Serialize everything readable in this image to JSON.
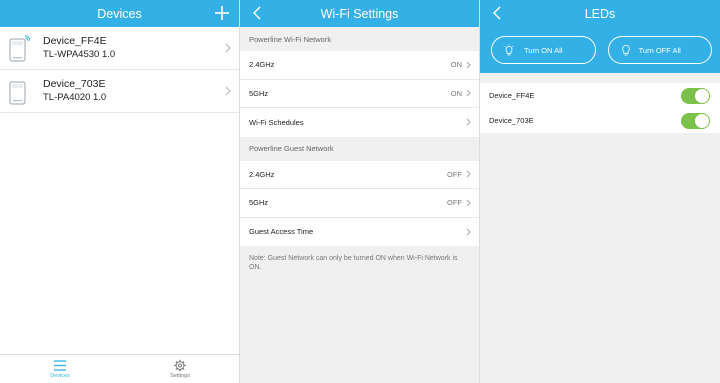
{
  "devices_panel": {
    "title": "Devices",
    "add_icon": "plus-icon",
    "devices": [
      {
        "name": "Device_FF4E",
        "model": "TL-WPA4530 1.0"
      },
      {
        "name": "Device_703E",
        "model": "TL-PA4020 1.0"
      }
    ],
    "tabs": [
      {
        "label": "Devices",
        "icon": "menu-icon",
        "active": true
      },
      {
        "label": "Settings",
        "icon": "gear-icon",
        "active": false
      }
    ]
  },
  "wifi_panel": {
    "title": "Wi-Fi Settings",
    "sections": [
      {
        "header": "Powerline Wi-Fi Network",
        "rows": [
          {
            "label": "2.4GHz",
            "value": "ON"
          },
          {
            "label": "5GHz",
            "value": "ON"
          },
          {
            "label": "Wi-Fi Schedules",
            "value": ""
          }
        ]
      },
      {
        "header": "Powerline Guest Network",
        "rows": [
          {
            "label": "2.4GHz",
            "value": "OFF"
          },
          {
            "label": "5GHz",
            "value": "OFF"
          },
          {
            "label": "Guest Access Time",
            "value": ""
          }
        ]
      }
    ],
    "note": "Note: Guest Network can only be turned ON when Wi-Fi Network is ON."
  },
  "leds_panel": {
    "title": "LEDs",
    "turn_on_label": "Turn ON All",
    "turn_off_label": "Turn OFF All",
    "devices": [
      {
        "name": "Device_FF4E",
        "led_on": true
      },
      {
        "name": "Device_703E",
        "led_on": true
      }
    ],
    "toggle_color": "#7cc14a"
  },
  "colors": {
    "accent": "#33b0e6",
    "background": "#f0f0f0"
  }
}
